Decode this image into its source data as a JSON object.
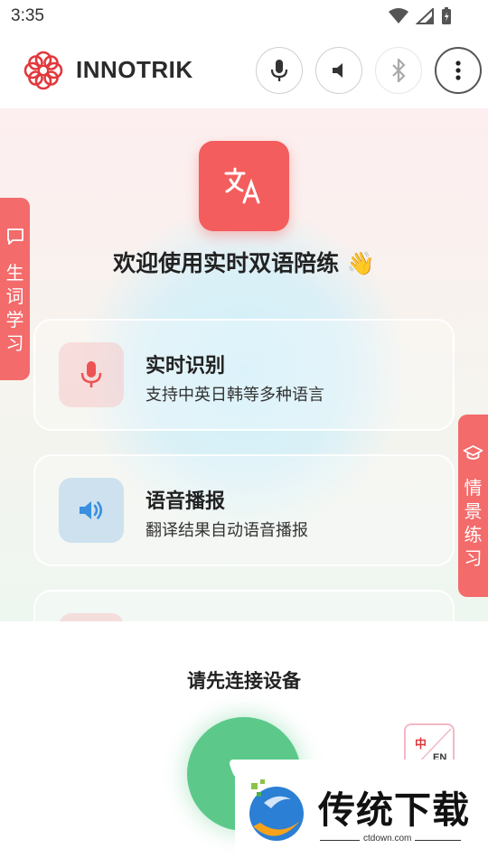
{
  "status_bar": {
    "time": "3:35"
  },
  "header": {
    "brand": "INNOTRIK",
    "buttons": [
      "mic-icon",
      "speaker-icon",
      "bluetooth-icon",
      "more-icon"
    ]
  },
  "main": {
    "welcome": "欢迎使用实时双语陪练 👋",
    "features": [
      {
        "title": "实时识别",
        "subtitle": "支持中英日韩等多种语言",
        "icon": "mic-icon"
      },
      {
        "title": "语音播报",
        "subtitle": "翻译结果自动语音播报",
        "icon": "volume-icon"
      },
      {
        "title": "",
        "subtitle": "",
        "icon": "partial-icon"
      }
    ]
  },
  "side_tabs": {
    "left": {
      "label": "生词学习",
      "chars": [
        "生",
        "词",
        "学",
        "习"
      ]
    },
    "right": {
      "label": "情景练习",
      "chars": [
        "情",
        "景",
        "练",
        "习"
      ]
    }
  },
  "bottom": {
    "connect_prompt": "请先连接设备",
    "lang_button": {
      "zh": "中",
      "en": "EN"
    }
  },
  "watermark": {
    "text": "传统下载",
    "url": "ctdown.com"
  },
  "colors": {
    "accent": "#f45d5d",
    "call": "#5cc98a",
    "blue_icon": "#3a8fe0"
  }
}
